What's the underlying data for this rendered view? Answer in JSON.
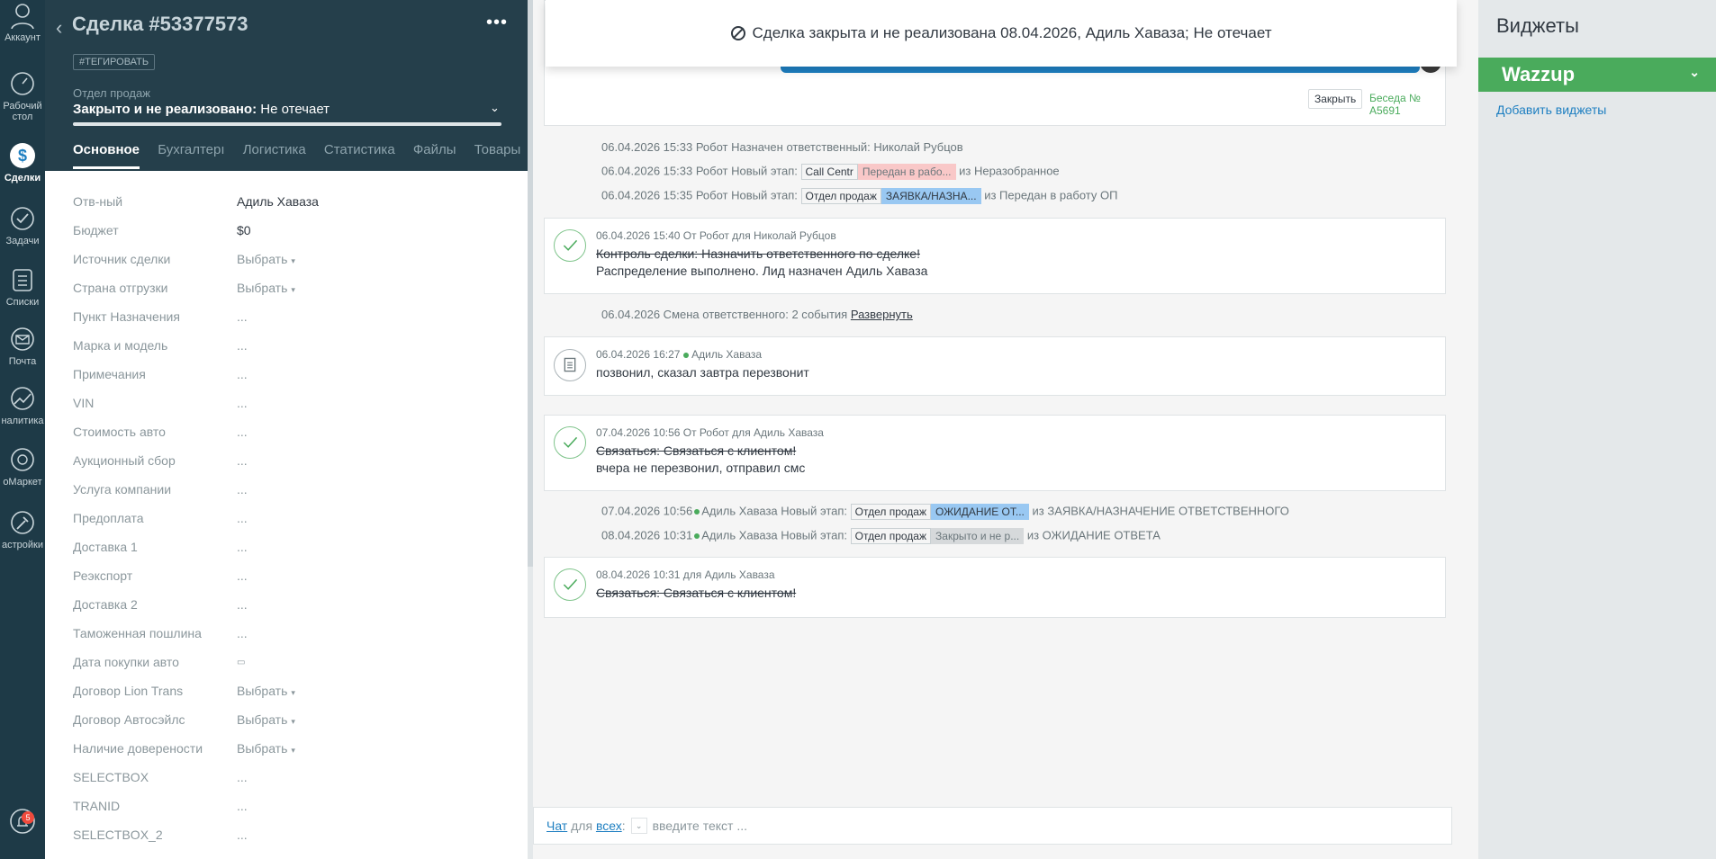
{
  "nav": {
    "items": [
      {
        "label": "Аккаунт",
        "icon": "account-icon"
      },
      {
        "label": "Рабочий стол",
        "icon": "dashboard-icon"
      },
      {
        "label": "Сделки",
        "icon": "deals-icon"
      },
      {
        "label": "Задачи",
        "icon": "tasks-icon"
      },
      {
        "label": "Списки",
        "icon": "lists-icon"
      },
      {
        "label": "Почта",
        "icon": "mail-icon"
      },
      {
        "label": "налитика",
        "icon": "analytics-icon"
      },
      {
        "label": "оМаркет",
        "icon": "market-icon"
      },
      {
        "label": "астройки",
        "icon": "settings-icon"
      }
    ],
    "notifications_count": "5"
  },
  "card": {
    "title": "Сделка #53377573",
    "more": "•••",
    "tag_button": "#ТЕГИРОВАТЬ",
    "pipeline": "Отдел продаж",
    "status_bold": "Закрыто и не реализовано:",
    "status_reason": " Не отечает",
    "tabs": [
      "Основное",
      "Бухгалтерı",
      "Логистика",
      "Статистика",
      "Файлы",
      "Товары",
      "•••"
    ],
    "fields": [
      {
        "label": "Отв-ный",
        "value": "Адиль Хаваза"
      },
      {
        "label": "Бюджет",
        "value": "$0"
      },
      {
        "label": "Источник сделки",
        "value": "Выбрать"
      },
      {
        "label": "Страна отгрузки",
        "value": "Выбрать"
      },
      {
        "label": "Пункт Назначения",
        "value": "..."
      },
      {
        "label": "Марка и модель",
        "value": "..."
      },
      {
        "label": "Примечания",
        "value": "..."
      },
      {
        "label": "VIN",
        "value": "..."
      },
      {
        "label": "Стоимость авто",
        "value": "..."
      },
      {
        "label": "Аукционный сбор",
        "value": "..."
      },
      {
        "label": "Услуга компании",
        "value": "..."
      },
      {
        "label": "Предоплата",
        "value": "..."
      },
      {
        "label": "Доставка 1",
        "value": "..."
      },
      {
        "label": "Реэкспорт",
        "value": "..."
      },
      {
        "label": "Доставка 2",
        "value": "..."
      },
      {
        "label": "Таможенная пошлина",
        "value": "..."
      },
      {
        "label": "Дата покупки авто",
        "value": ""
      },
      {
        "label": "Договор Lion Trans",
        "value": "Выбрать"
      },
      {
        "label": "Договор Автосэйлс",
        "value": "Выбрать"
      },
      {
        "label": "Наличие доверености",
        "value": "Выбрать"
      },
      {
        "label": "SELECTBOX",
        "value": "..."
      },
      {
        "label": "TRANID",
        "value": "..."
      },
      {
        "label": "SELECTBOX_2",
        "value": "..."
      }
    ]
  },
  "toast": "Сделка закрыта и не реализована 08.04.2026, Адиль Хаваза; Не отечает",
  "chat": {
    "close_button": "Закрыть",
    "conversation": "Беседа № А5691"
  },
  "events": {
    "e1": "06.04.2026 15:33 Робот Назначен ответственный: Николай Рубцов",
    "e2_prefix": "06.04.2026 15:33 Робот Новый этап:",
    "e2_pipe": "Call Centr",
    "e2_stage": "Передан в рабо...",
    "e2_from": "из Неразобранное",
    "e3_prefix": "06.04.2026 15:35 Робот Новый этап:",
    "e3_pipe": "Отдел продаж",
    "e3_stage": "ЗАЯВКА/НАЗНА...",
    "e3_from": "из Передан в работу ОП",
    "e4_prefix": "06.04.2026 Смена ответственного: 2 события",
    "e4_link": "Развернуть",
    "e5_prefix": "07.04.2026 10:56",
    "e5_user": "Адиль Хаваза Новый этап:",
    "e5_pipe": "Отдел продаж",
    "e5_stage": "ОЖИДАНИЕ ОТ...",
    "e5_from": "из ЗАЯВКА/НАЗНАЧЕНИЕ ОТВЕТСТВЕННОГО",
    "e6_prefix": "08.04.2026 10:31",
    "e6_user": "Адиль Хаваза Новый этап:",
    "e6_pipe": "Отдел продаж",
    "e6_stage": "Закрыто и не р...",
    "e6_from": "из ОЖИДАНИЕ ОТВЕТА"
  },
  "tasks": {
    "t1_meta": "06.04.2026 15:40  От Робот для Николай Рубцов",
    "t1_line1": "Контроль сделки: Назначить ответственного по сделке!",
    "t1_line2": "Распределение выполнено. Лид назначен Адиль Хаваза",
    "note_meta_date": "06.04.2026 16:27",
    "note_meta_user": "Адиль Хаваза",
    "note_text": "позвонил, сказал завтра перезвонит",
    "t2_meta": "07.04.2026 10:56  От Робот для Адиль Хаваза",
    "t2_line1": "Связаться: Связаться с клиентом!",
    "t2_line2": "вчера не перезвонил, отправил смс",
    "t3_meta": "08.04.2026 10:31  для Адиль Хаваза",
    "t3_line1": "Связаться: Связаться с клиентом!"
  },
  "composer": {
    "chat_link": "Чат",
    "for": "для",
    "all_link": "всех",
    "colon": ":",
    "placeholder": "введите текст ..."
  },
  "widgets": {
    "title": "Виджеты",
    "wazzup": "Wazzup",
    "add": "Добавить виджеты"
  }
}
